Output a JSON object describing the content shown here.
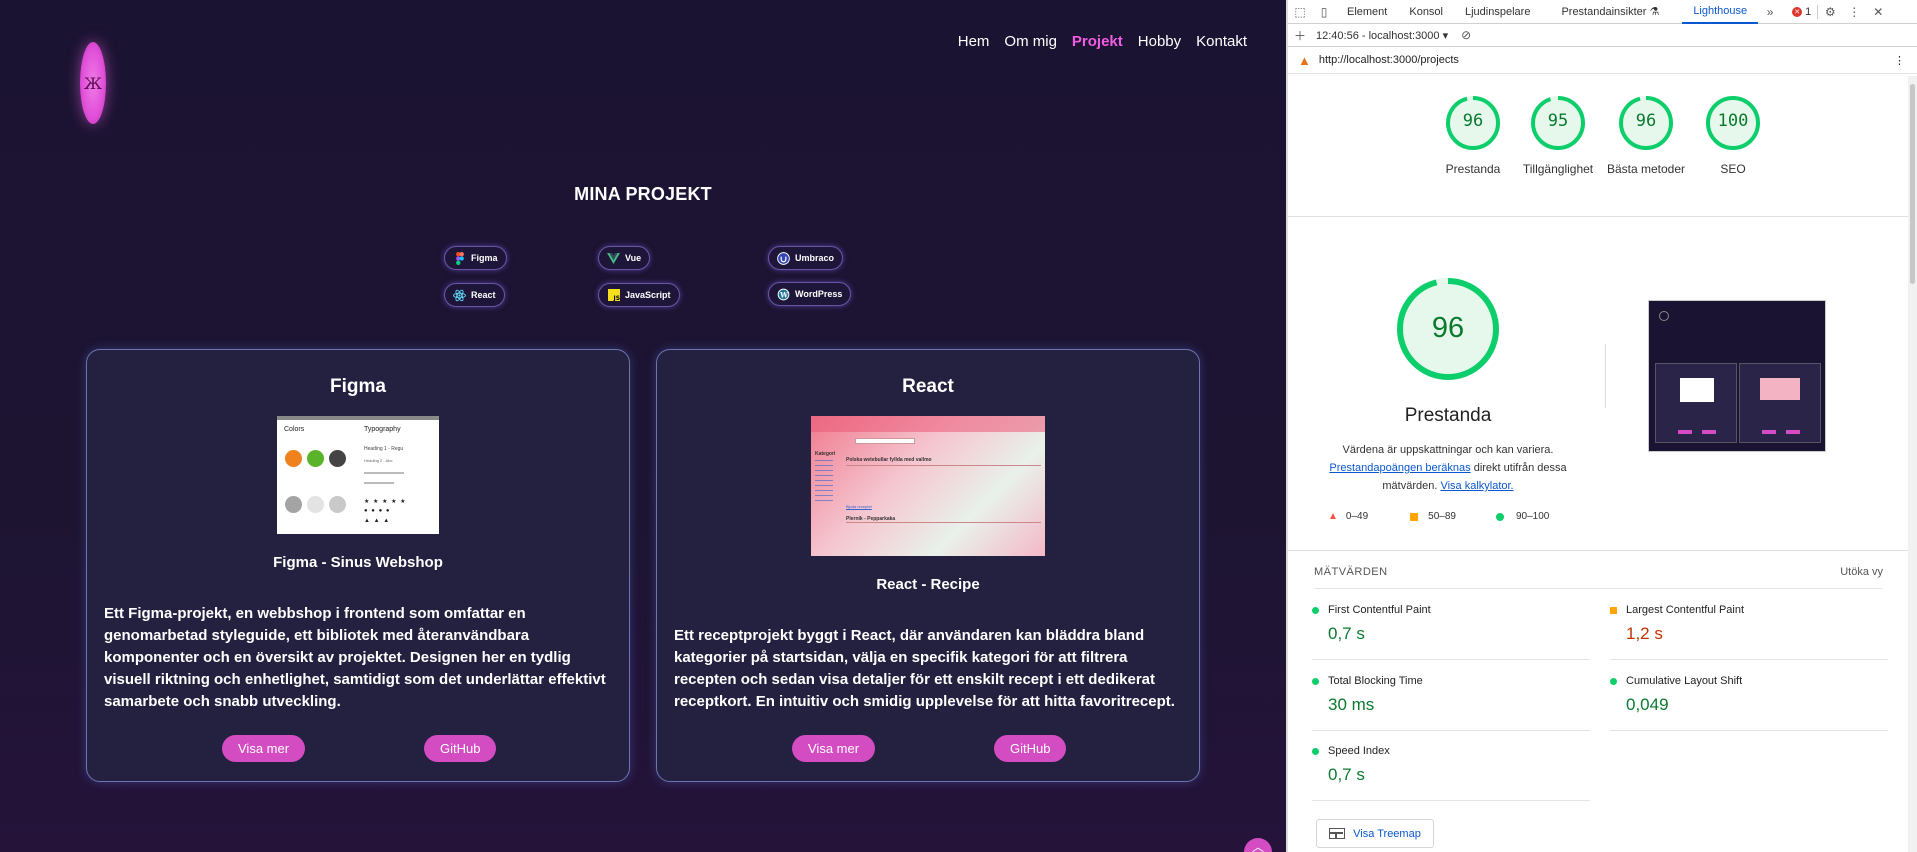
{
  "site": {
    "logo_glyph": "Ж",
    "nav": [
      "Hem",
      "Om mig",
      "Projekt",
      "Hobby",
      "Kontakt"
    ],
    "active_nav": "Projekt",
    "title": "MINA PROJEKT",
    "tech": [
      "Figma",
      "Vue",
      "Umbraco",
      "React",
      "JavaScript",
      "WordPress"
    ],
    "cards": [
      {
        "heading": "Figma",
        "subtitle": "Figma - Sinus Webshop",
        "description": "Ett Figma-projekt, en webbshop i frontend som omfattar en genomarbetad styleguide, ett bibliotek med återanvändbara komponenter och en översikt av projektet. Designen her en tydlig visuell riktning och enhetlighet, samtidigt som det underlättar effektivt samarbete och snabb utveckling.",
        "btn_more": "Visa mer",
        "btn_github": "GitHub",
        "thumb": {
          "colors": "Colors",
          "typography": "Typography",
          "heading": "Heading 1 - Regu",
          "heading2": "Heading 2 - Abc"
        }
      },
      {
        "heading": "React",
        "subtitle": "React - Recipe",
        "description": "Ett receptprojekt byggt i React, där användaren kan bläddra bland kategorier på startsidan, välja en specifik kategori för att filtrera recepten och sedan visa detaljer för ett enskilt recept i ett dedikerat receptkort. En intuitiv och smidig upplevelse för att hitta favoritrecept.",
        "btn_more": "Visa mer",
        "btn_github": "GitHub",
        "thumb": {
          "category": "Kategori",
          "recipe1": "Polska wetebullar fyllda med vallmo",
          "recipe2": "Plerník - Pepparkaka",
          "link": "Bjuda receptet"
        }
      }
    ],
    "colors": {
      "accent": "#d44cc2",
      "nav_active": "#f25ce3",
      "bg": "#1b1332",
      "card": "#242040"
    }
  },
  "devtools": {
    "tabs": [
      "Element",
      "Konsol",
      "Ljudinspelare",
      "Prestandainsikter",
      "Lighthouse"
    ],
    "active_tab": "Lighthouse",
    "error_count": "1",
    "session": "12:40:56 - localhost:3000",
    "url": "http://localhost:3000/projects",
    "scores": [
      {
        "value": 96,
        "label": "Prestanda"
      },
      {
        "value": 95,
        "label": "Tillgänglighet"
      },
      {
        "value": 96,
        "label": "Bästa metoder"
      },
      {
        "value": 100,
        "label": "SEO"
      }
    ],
    "main_score": 96,
    "main_label": "Prestanda",
    "note_1": "Värdena är uppskattningar och kan variera.",
    "note_link1": "Prestandapoängen beräknas",
    "note_2": " direkt utifrån dessa mätvärden. ",
    "note_link2": "Visa kalkylator.",
    "legend": [
      "0–49",
      "50–89",
      "90–100"
    ],
    "metrics_title": "MÄTVÄRDEN",
    "expand": "Utöka vy",
    "metrics": [
      {
        "name": "First Contentful Paint",
        "value": "0,7 s",
        "status": "good"
      },
      {
        "name": "Largest Contentful Paint",
        "value": "1,2 s",
        "status": "average"
      },
      {
        "name": "Total Blocking Time",
        "value": "30 ms",
        "status": "good"
      },
      {
        "name": "Cumulative Layout Shift",
        "value": "0,049",
        "status": "good"
      },
      {
        "name": "Speed Index",
        "value": "0,7 s",
        "status": "good"
      }
    ],
    "treemap": "Visa Treemap",
    "colors": {
      "good": "#0cce6b",
      "average": "#ffa400",
      "poor": "#ff4e42",
      "good_text": "#0a7a2f",
      "average_text": "#c33300",
      "link": "#0b57d0"
    }
  }
}
